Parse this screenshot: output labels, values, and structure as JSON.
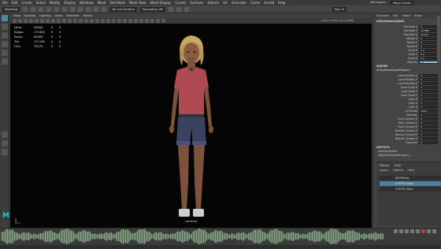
{
  "menubar": {
    "items": [
      "File",
      "Edit",
      "Create",
      "Select",
      "Modify",
      "Display",
      "Windows",
      "Mesh",
      "Edit Mesh",
      "Mesh Tools",
      "Mesh Display",
      "Curves",
      "Surfaces",
      "Deform",
      "UV",
      "Generate",
      "Cache",
      "Arnold",
      "Help"
    ],
    "workspace_label": "Workspace:",
    "workspace_value": "Maya Classic",
    "sign_in": "Sign In"
  },
  "statusline": {
    "mode": "Modeling",
    "no_live": "No Live Surface",
    "symmetry": "Symmetry: Off"
  },
  "viewport": {
    "menu": [
      "View",
      "Shading",
      "Lighting",
      "Show",
      "Renderer",
      "Panels"
    ],
    "hud": [
      {
        "label": "Verts:",
        "v1": "50644",
        "v2": "0",
        "v3": "0"
      },
      {
        "label": "Edges:",
        "v1": "171928",
        "v2": "0",
        "v3": "0"
      },
      {
        "label": "Faces:",
        "v1": "85620",
        "v2": "0",
        "v3": "0"
      },
      {
        "label": "Tris:",
        "v1": "171108",
        "v2": "0",
        "v3": "0"
      },
      {
        "label": "UVs:",
        "v1": "70274",
        "v2": "0",
        "v3": "0"
      }
    ],
    "camera": "camera1",
    "color_space": "ACES 1.0 SDR-video (sRGB)"
  },
  "channelbox": {
    "tabs": [
      "Channels",
      "Edit",
      "Object",
      "Show"
    ],
    "node1": "aiSkyDomeLight1",
    "attrs1": [
      {
        "label": "Translate X",
        "value": "0"
      },
      {
        "label": "Translate Y",
        "value": "18.888"
      },
      {
        "label": "Translate Z",
        "value": "19.311"
      },
      {
        "label": "Rotate X",
        "value": "0"
      },
      {
        "label": "Rotate Y",
        "value": "0"
      },
      {
        "label": "Rotate Z",
        "value": "0"
      },
      {
        "label": "Scale X",
        "value": "0.4"
      },
      {
        "label": "Scale Y",
        "value": "0.4"
      },
      {
        "label": "Scale Z",
        "value": "0.4"
      },
      {
        "label": "Visibility",
        "value": "on"
      }
    ],
    "shapes_header": "SHAPES",
    "node2": "aiSkyDomeLightShape1",
    "attrs2": [
      {
        "label": "Local Position X",
        "value": "0"
      },
      {
        "label": "Local Position Y",
        "value": "0"
      },
      {
        "label": "Local Position Z",
        "value": "0"
      },
      {
        "label": "Local Scale X",
        "value": "1"
      },
      {
        "label": "Local Scale Y",
        "value": "1"
      },
      {
        "label": "Local Scale Z",
        "value": "1"
      },
      {
        "label": "Color R",
        "value": "1"
      },
      {
        "label": "Color G",
        "value": "1"
      },
      {
        "label": "Color B",
        "value": "1"
      },
      {
        "label": "Ai Format",
        "value": "1000"
      },
      {
        "label": "Intensity",
        "value": "1"
      },
      {
        "label": "Point Camera X",
        "value": "0"
      },
      {
        "label": "Point Camera Y",
        "value": "0"
      },
      {
        "label": "Point Camera Z",
        "value": "0"
      },
      {
        "label": "Normal Camera X",
        "value": "1"
      },
      {
        "label": "Normal Camera Y",
        "value": "1"
      },
      {
        "label": "Normal Camera Z",
        "value": "1"
      },
      {
        "label": "Exposure",
        "value": "0"
      }
    ],
    "inputs_header": "OUTPUTS",
    "inputs_node": "defaultLightSet",
    "inputs_node2": "aiSkyDomeLightShape1_s"
  },
  "layers": {
    "tabs": [
      "Display",
      "Anim"
    ],
    "menu": [
      "Layers",
      "Options",
      "Help"
    ],
    "rows": [
      {
        "name": "NECKbody",
        "selected": false
      },
      {
        "name": "CHOTEL.body",
        "selected": true
      },
      {
        "name": "CHOTEL.Bara",
        "selected": false
      }
    ]
  },
  "colors": {
    "accent": "#2ac6c8",
    "selection": "#4d7f9c",
    "record": "#d23a3a"
  }
}
